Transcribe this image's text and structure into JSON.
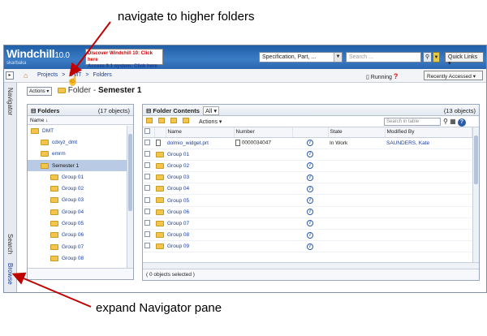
{
  "annotations": {
    "top": "navigate to higher folders",
    "bottom": "expand Navigator pane"
  },
  "header": {
    "app_name": "Windchill",
    "version": "10.0",
    "subtitle": "skarbaka",
    "promo_line1": "Discover Windchill 10: Click here",
    "promo_line2": "Access 9.1 system: Click here",
    "search_type": "Specification, Part, ...",
    "search_placeholder": "Search ...",
    "quick_links": "Quick Links"
  },
  "breadcrumb": {
    "items": [
      "Projects",
      ">",
      "DMT",
      ">",
      "Folders"
    ],
    "status": "Running",
    "recently_accessed": "Recently Accessed"
  },
  "sidebar": {
    "navigator": "Navigator",
    "search": "Search",
    "browse": "Browse"
  },
  "page_title": {
    "actions": "Actions",
    "folder_label": "Folder -",
    "folder_name": "Semester 1"
  },
  "folders_panel": {
    "title": "Folders",
    "count": "(17 objects)",
    "name_col": "Name",
    "tree": [
      {
        "label": "DMT",
        "level": 0,
        "selected": false
      },
      {
        "label": "cdxyz_dmt",
        "level": 1,
        "selected": false
      },
      {
        "label": "emrm",
        "level": 1,
        "selected": false
      },
      {
        "label": "Semester 1",
        "level": 1,
        "selected": true
      },
      {
        "label": "Group 01",
        "level": 2,
        "selected": false
      },
      {
        "label": "Group 02",
        "level": 2,
        "selected": false
      },
      {
        "label": "Group 03",
        "level": 2,
        "selected": false
      },
      {
        "label": "Group 04",
        "level": 2,
        "selected": false
      },
      {
        "label": "Group 05",
        "level": 2,
        "selected": false
      },
      {
        "label": "Group 06",
        "level": 2,
        "selected": false
      },
      {
        "label": "Group 07",
        "level": 2,
        "selected": false
      },
      {
        "label": "Group 08",
        "level": 2,
        "selected": false
      }
    ]
  },
  "contents_panel": {
    "title": "Folder Contents",
    "view": "All",
    "count": "(13 objects)",
    "actions": "Actions",
    "search_placeholder": "Search in table",
    "columns": [
      "Name",
      "Number",
      "State",
      "Modified By"
    ],
    "rows": [
      {
        "name": "dolmio_widget.prt",
        "number": "0000034047",
        "state": "In Work",
        "modified_by": "SAUNDERS, Kate",
        "type": "doc"
      },
      {
        "name": "Group 01",
        "number": "",
        "state": "",
        "modified_by": "",
        "type": "folder"
      },
      {
        "name": "Group 02",
        "number": "",
        "state": "",
        "modified_by": "",
        "type": "folder"
      },
      {
        "name": "Group 03",
        "number": "",
        "state": "",
        "modified_by": "",
        "type": "folder"
      },
      {
        "name": "Group 04",
        "number": "",
        "state": "",
        "modified_by": "",
        "type": "folder"
      },
      {
        "name": "Group 05",
        "number": "",
        "state": "",
        "modified_by": "",
        "type": "folder"
      },
      {
        "name": "Group 06",
        "number": "",
        "state": "",
        "modified_by": "",
        "type": "folder"
      },
      {
        "name": "Group 07",
        "number": "",
        "state": "",
        "modified_by": "",
        "type": "folder"
      },
      {
        "name": "Group 08",
        "number": "",
        "state": "",
        "modified_by": "",
        "type": "folder"
      },
      {
        "name": "Group 09",
        "number": "",
        "state": "",
        "modified_by": "",
        "type": "folder"
      }
    ],
    "footer": "( 0 objects selected )"
  },
  "colors": {
    "header_blue": "#2b66ad",
    "link_blue": "#1a3e9a",
    "selection": "#b9cbe4",
    "arrow_red": "#c00000",
    "folder_yellow": "#f3c54c"
  }
}
